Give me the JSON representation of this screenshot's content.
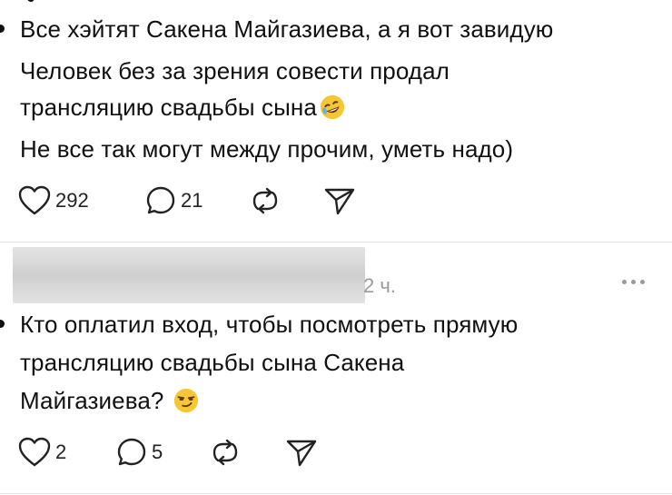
{
  "post1": {
    "lines": [
      "Все хэйтят Сакена Майгазиева, а я вот завидую",
      "Человек без за зрения совести продал",
      "трансляцию свадьбы сына",
      "Не все так могут между прочим, уметь надо)"
    ],
    "emoji": "rolling-on-floor-laughing",
    "likes": "292",
    "replies": "21"
  },
  "post2": {
    "timestamp": "2 ч.",
    "lines": [
      "Кто оплатил вход, чтобы посмотреть прямую",
      "трансляцию свадьбы сына Сакена",
      "Майгазиева?"
    ],
    "emoji": "smirking-face",
    "likes": "2",
    "replies": "5"
  }
}
